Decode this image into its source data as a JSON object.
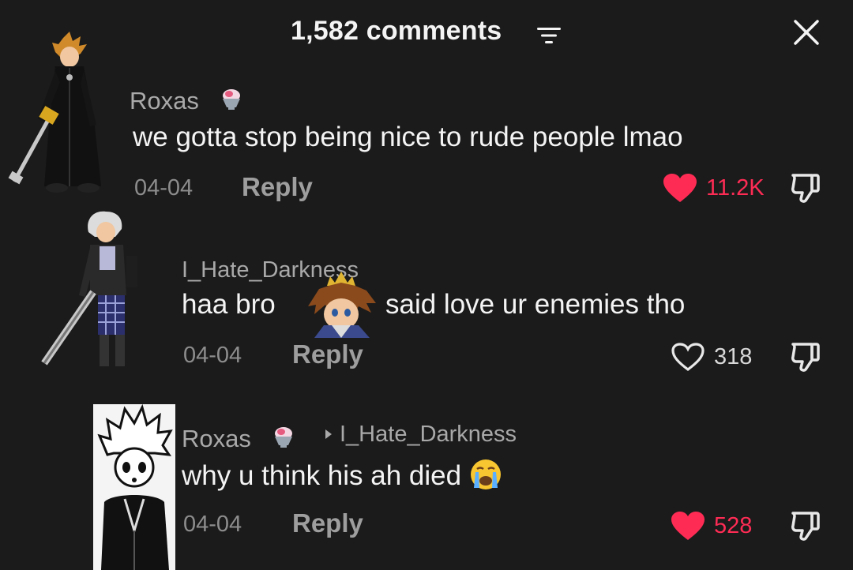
{
  "header": {
    "title": "1,582 comments",
    "sort_icon": "sort-lines-icon",
    "close_icon": "close-x-icon"
  },
  "colors": {
    "background": "#1b1b1b",
    "liked_heart": "#fe2c55",
    "liked_count": "#fe2c55",
    "muted_text": "#a9a9a9",
    "primary_text": "#f4f4f4"
  },
  "comments": [
    {
      "username": "Roxas",
      "badge_icon": "shaved-ice-emoji",
      "text": "we gotta stop being nice to rude people lmao",
      "date": "04-04",
      "reply_label": "Reply",
      "likes": "11.2K",
      "liked": true
    },
    {
      "username": "I_Hate_Darkness",
      "text_before": "haa bro",
      "sticker_icon": "sora-face-sticker",
      "text_after": "said love ur enemies tho",
      "date": "04-04",
      "reply_label": "Reply",
      "likes": "318",
      "liked": false
    },
    {
      "username": "Roxas",
      "badge_icon": "shaved-ice-emoji",
      "reply_to": "I_Hate_Darkness",
      "text": "why u think his ah died",
      "trailing_emoji": "loudly-crying-face-emoji",
      "date": "04-04",
      "reply_label": "Reply",
      "likes": "528",
      "liked": true
    }
  ]
}
